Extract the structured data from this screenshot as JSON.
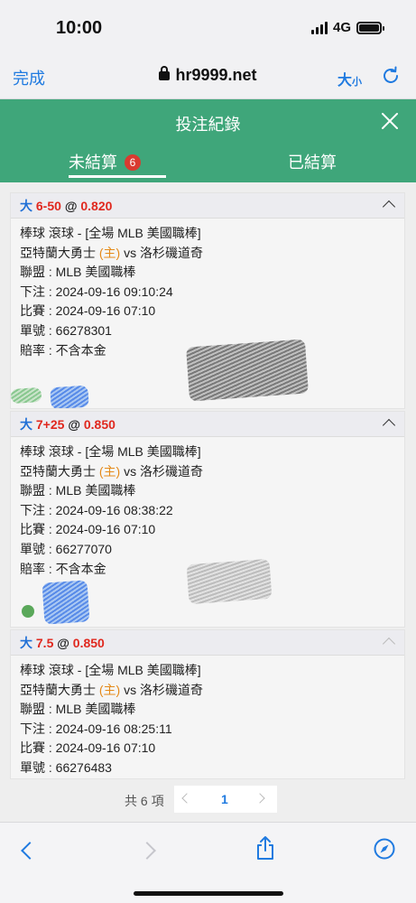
{
  "status_bar": {
    "time": "10:00",
    "network": "4G",
    "icons": [
      "signal-icon",
      "battery-icon"
    ]
  },
  "browser": {
    "done_label": "完成",
    "url": "hr9999.net",
    "text_size_big": "大",
    "text_size_small": "小",
    "icons": [
      "lock-icon",
      "reload-icon"
    ]
  },
  "header": {
    "title": "投注紀錄",
    "close_icon": "close-icon"
  },
  "tabs": [
    {
      "label": "未結算",
      "badge": "6",
      "active": true
    },
    {
      "label": "已結算",
      "active": false
    }
  ],
  "bets": [
    {
      "ou": "大",
      "line": "6-50",
      "at": "@",
      "odds": "0.820",
      "rows": {
        "sport": "棒球 滾球 - [全場 MLB 美國職棒]",
        "home_team": "亞特蘭大勇士",
        "home_tag": "(主)",
        "vs": "vs",
        "away_team": "洛杉磯道奇",
        "league": "聯盟 : MLB 美國職棒",
        "placed": "下注 : 2024-09-16 09:10:24",
        "match": "比賽 : 2024-09-16 07:10",
        "ticket": "單號 : 66278301",
        "odds_type": "賠率 : 不含本金"
      }
    },
    {
      "ou": "大",
      "line": "7+25",
      "at": "@",
      "odds": "0.850",
      "rows": {
        "sport": "棒球 滾球 - [全場 MLB 美國職棒]",
        "home_team": "亞特蘭大勇士",
        "home_tag": "(主)",
        "vs": "vs",
        "away_team": "洛杉磯道奇",
        "league": "聯盟 : MLB 美國職棒",
        "placed": "下注 : 2024-09-16 08:38:22",
        "match": "比賽 : 2024-09-16 07:10",
        "ticket": "單號 : 66277070",
        "odds_type": "賠率 : 不含本金"
      }
    },
    {
      "ou": "大",
      "line": "7.5",
      "at": "@",
      "odds": "0.850",
      "rows": {
        "sport": "棒球 滾球 - [全場 MLB 美國職棒]",
        "home_team": "亞特蘭大勇士",
        "home_tag": "(主)",
        "vs": "vs",
        "away_team": "洛杉磯道奇",
        "league": "聯盟 : MLB 美國職棒",
        "placed": "下注 : 2024-09-16 08:25:11",
        "match": "比賽 : 2024-09-16 07:10",
        "ticket": "單號 : 66276483"
      }
    }
  ],
  "pagination": {
    "total": "共 6 項",
    "current_page": "1"
  },
  "toolbar": {
    "icons": [
      "back-icon",
      "forward-icon",
      "share-icon",
      "compass-icon"
    ]
  },
  "colors": {
    "header_green": "#3fa67a",
    "accent_blue": "#1f7ae0",
    "odds_red": "#e0281e",
    "badge_red": "#d93b30",
    "home_orange": "#e58a1a"
  }
}
